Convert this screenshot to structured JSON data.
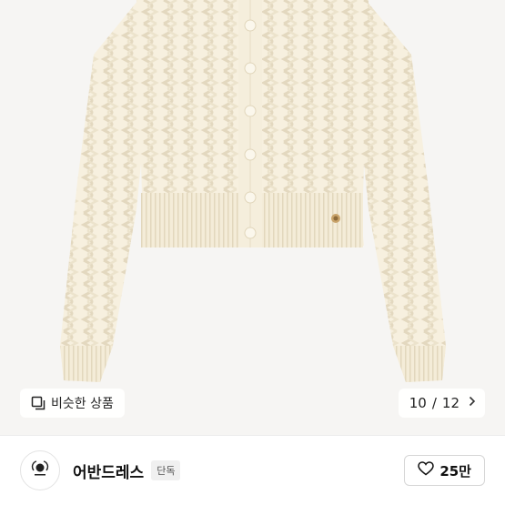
{
  "similar": {
    "label": "비슷한 상품",
    "icon": "copy-icon"
  },
  "pager": {
    "current": "10",
    "separator": "/",
    "total": "12",
    "icon": "chevron-right-icon"
  },
  "seller": {
    "name": "어반드레스",
    "badge": "단독",
    "avatar_icon": "brand-logo-icon"
  },
  "like": {
    "count": "25만",
    "icon": "heart-icon"
  },
  "colors": {
    "sweater": "#f7f0df",
    "background": "#f6f5f3",
    "brand_text": "#111111"
  }
}
